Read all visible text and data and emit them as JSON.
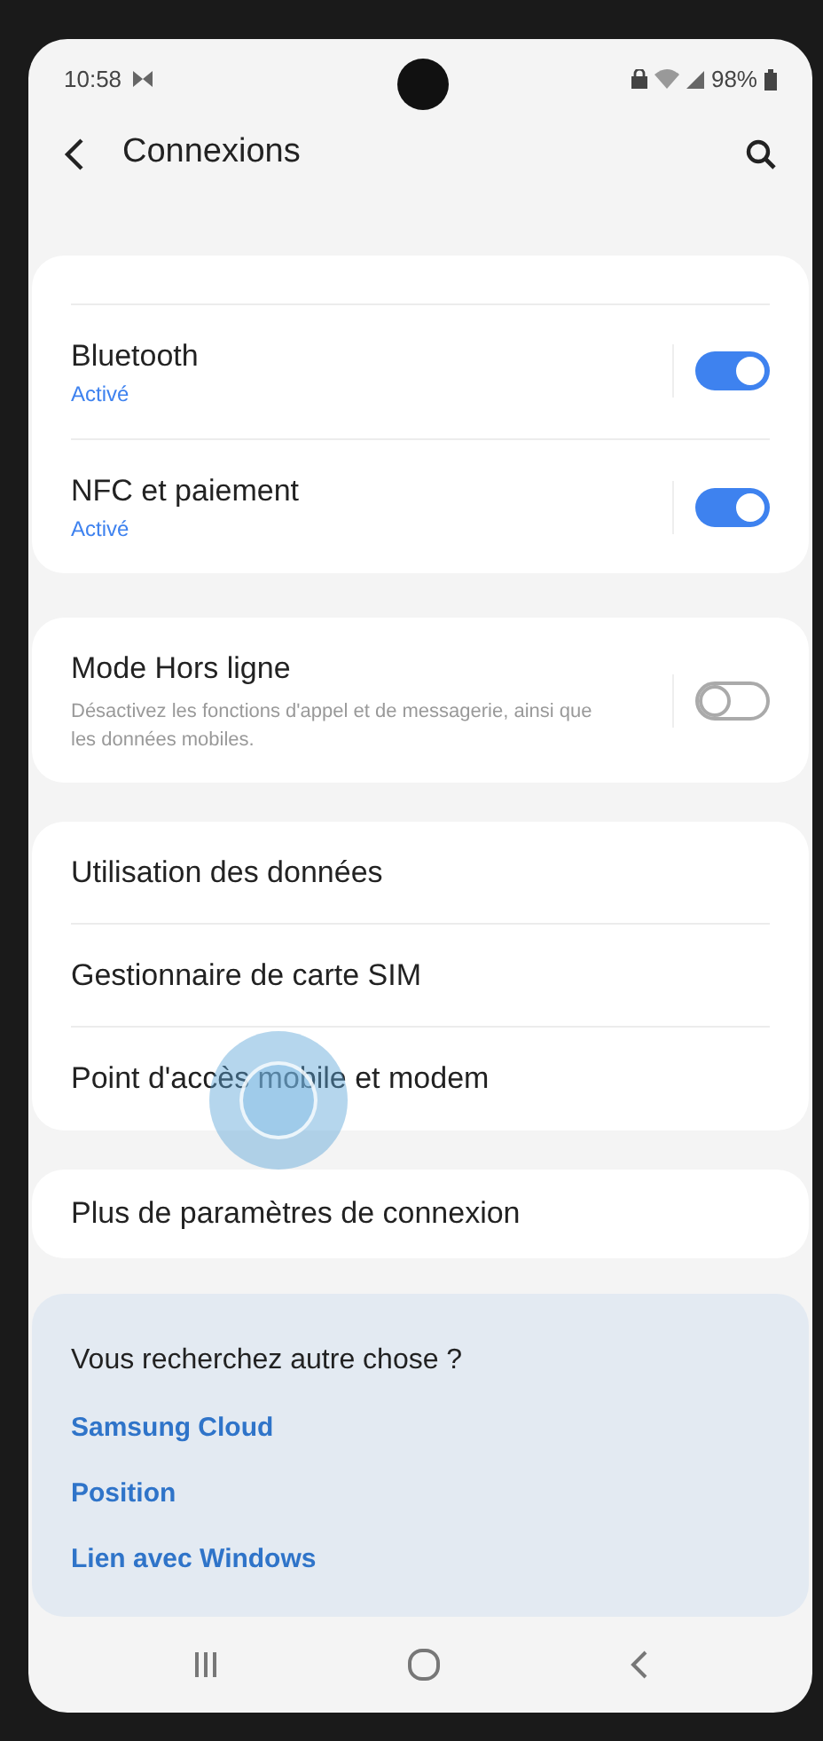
{
  "status_bar": {
    "time": "10:58",
    "battery": "98%"
  },
  "header": {
    "title": "Connexions"
  },
  "toggle_group": [
    {
      "title": "Bluetooth",
      "subtitle": "Activé",
      "on": true
    },
    {
      "title": "NFC et paiement",
      "subtitle": "Activé",
      "on": true
    }
  ],
  "airplane": {
    "title": "Mode Hors ligne",
    "description": "Désactivez les fonctions d'appel et de messagerie, ainsi que les données mobiles.",
    "on": false
  },
  "menu_items": [
    "Utilisation des données",
    "Gestionnaire de carte SIM",
    "Point d'accès mobile et modem"
  ],
  "more_item": "Plus de paramètres de connexion",
  "suggestions": {
    "heading": "Vous recherchez autre chose ?",
    "links": [
      "Samsung Cloud",
      "Position",
      "Lien avec Windows"
    ]
  }
}
